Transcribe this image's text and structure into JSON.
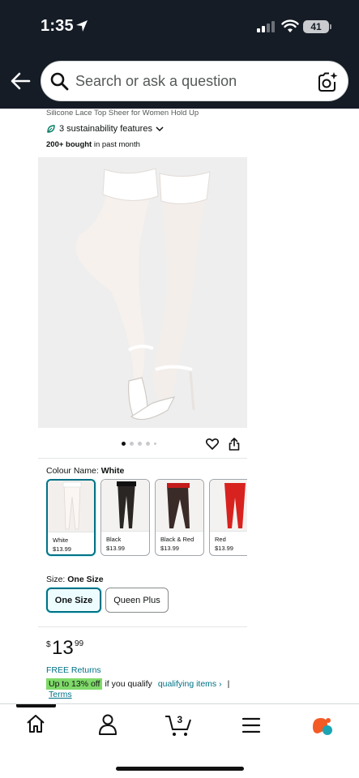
{
  "status": {
    "time": "1:35",
    "battery": "41"
  },
  "search": {
    "placeholder": "Search or ask a question"
  },
  "product": {
    "subtitle": "Silicone Lace Top Sheer for Women Hold Up",
    "sustainability": "3 sustainability features",
    "bought_bold": "200+ bought",
    "bought_rest": " in past month",
    "image_count": 5,
    "active_image": 1
  },
  "colour": {
    "label": "Colour Name: ",
    "selected": "White",
    "options": [
      {
        "name": "White",
        "price": "$13.99",
        "color": "#f3e9e4"
      },
      {
        "name": "Black",
        "price": "$13.99",
        "color": "#1a1a1a"
      },
      {
        "name": "Black & Red",
        "price": "$13.99",
        "color": "#8b1a1a"
      },
      {
        "name": "Red",
        "price": "$13.99",
        "color": "#d8221f"
      }
    ]
  },
  "size": {
    "label": "Size: ",
    "selected": "One Size",
    "options": [
      "One Size",
      "Queen Plus"
    ]
  },
  "price": {
    "symbol": "$",
    "whole": "13",
    "fraction": "99"
  },
  "returns": {
    "label": "FREE Returns"
  },
  "promo": {
    "badge": "Up to 13% off",
    "text": "if you qualify",
    "link": "qualifying items ›",
    "separator": "|",
    "terms": "Terms"
  },
  "nav": {
    "items": [
      "home-icon",
      "account-icon",
      "cart-icon",
      "menu-icon",
      "rufus-icon"
    ],
    "cart_count": "3"
  },
  "colors": {
    "header": "#151c26",
    "accent": "#007185",
    "promo": "#7fda69"
  }
}
